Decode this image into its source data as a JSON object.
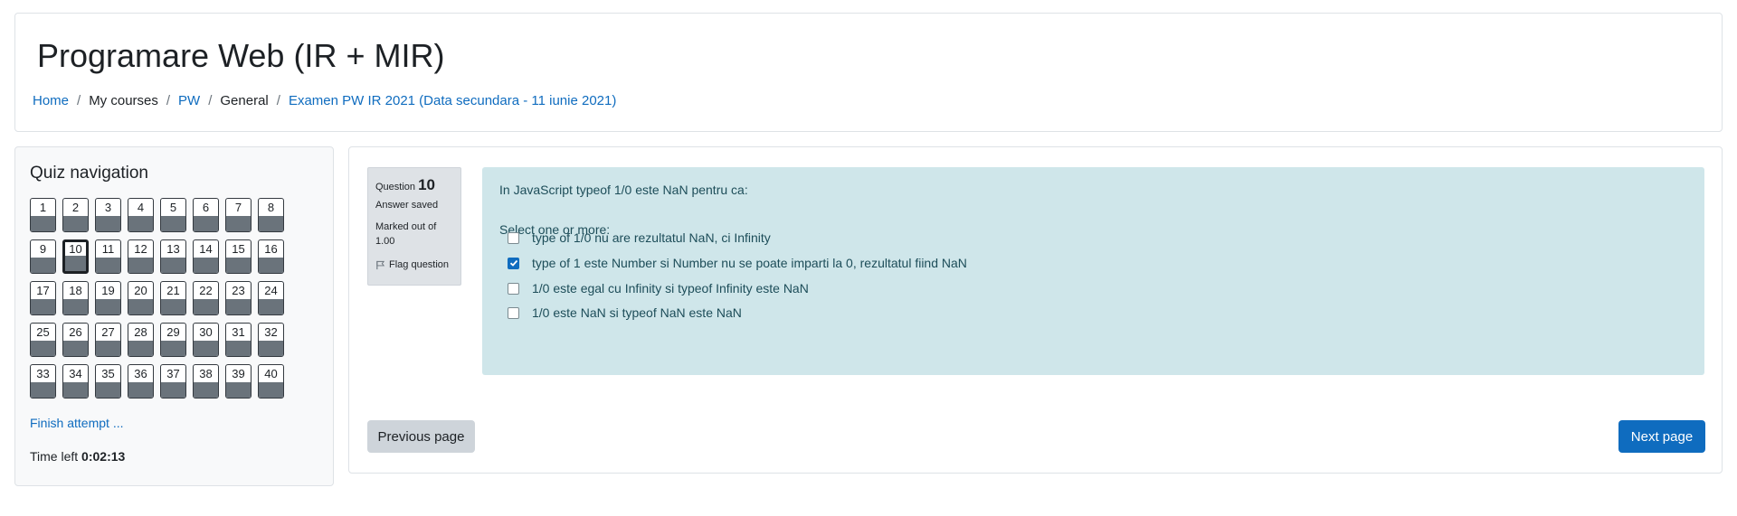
{
  "header": {
    "title": "Programare Web (IR + MIR)",
    "breadcrumb": [
      {
        "label": "Home",
        "link": true
      },
      {
        "label": "My courses",
        "link": false
      },
      {
        "label": "PW",
        "link": true
      },
      {
        "label": "General",
        "link": false
      },
      {
        "label": "Examen PW IR 2021 (Data secundara - 11 iunie 2021)",
        "link": true
      }
    ],
    "separator": "/"
  },
  "quiz_nav": {
    "title": "Quiz navigation",
    "current_question": 10,
    "question_count": 40,
    "finish_label": "Finish attempt ...",
    "time_left_label": "Time left",
    "time_left_value": "0:02:13"
  },
  "question": {
    "label": "Question",
    "number": "10",
    "state": "Answer saved",
    "grade": "Marked out of 1.00",
    "flag_label": "Flag question",
    "flag_icon": "flag-icon",
    "text": "In JavaScript typeof 1/0 este NaN pentru ca:",
    "prompt": "Select one or more:",
    "options": [
      {
        "label": "type of 1/0 nu are rezultatul NaN, ci Infinity",
        "checked": false
      },
      {
        "label": "type of 1 este Number si Number nu se poate imparti la 0, rezultatul fiind NaN",
        "checked": true
      },
      {
        "label": "1/0 este egal cu Infinity si typeof Infinity este NaN",
        "checked": false
      },
      {
        "label": "1/0 este NaN si typeof NaN este NaN",
        "checked": false
      }
    ]
  },
  "navigation": {
    "previous_label": "Previous page",
    "next_label": "Next page"
  },
  "colors": {
    "accent": "#0f6cbf",
    "question_bg": "#cfe6ea",
    "answered_fill": "#6a737b"
  }
}
